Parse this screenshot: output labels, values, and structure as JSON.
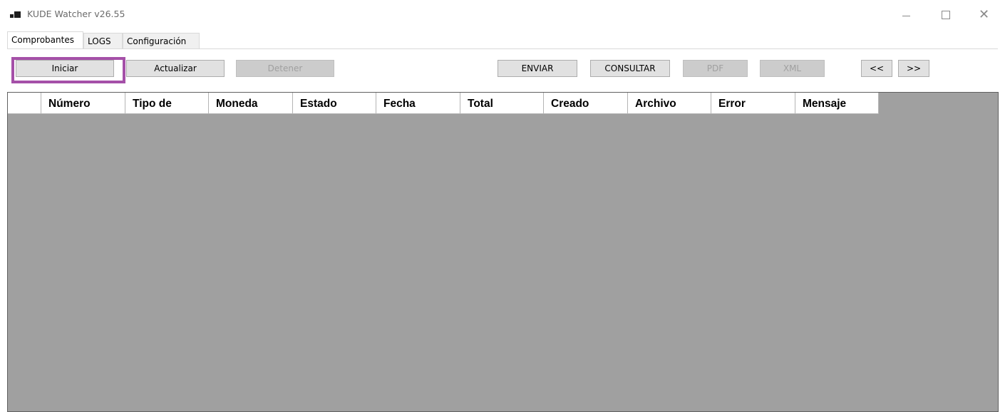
{
  "window": {
    "title": "KUDE Watcher v26.55",
    "controls": {
      "minimize": "—",
      "maximize": "☐",
      "close": "✕"
    }
  },
  "tabs": [
    {
      "label": "Comprobantes",
      "active": true
    },
    {
      "label": "LOGS",
      "active": false
    },
    {
      "label": "Configuración",
      "active": false
    }
  ],
  "toolbar": {
    "iniciar": "Iniciar",
    "actualizar": "Actualizar",
    "detener": "Detener",
    "enviar": "ENVIAR",
    "consultar": "CONSULTAR",
    "pdf": "PDF",
    "xml": "XML",
    "prev": "<<",
    "next": ">>"
  },
  "grid": {
    "columns": [
      "Número",
      "Tipo de",
      "Moneda",
      "Estado",
      "Fecha",
      "Total",
      "Creado",
      "Archivo",
      "Error",
      "Mensaje"
    ],
    "rows": []
  },
  "colors": {
    "highlight": "#a550a8",
    "grid_background": "#a0a0a0",
    "disabled_button": "#cccccc"
  }
}
